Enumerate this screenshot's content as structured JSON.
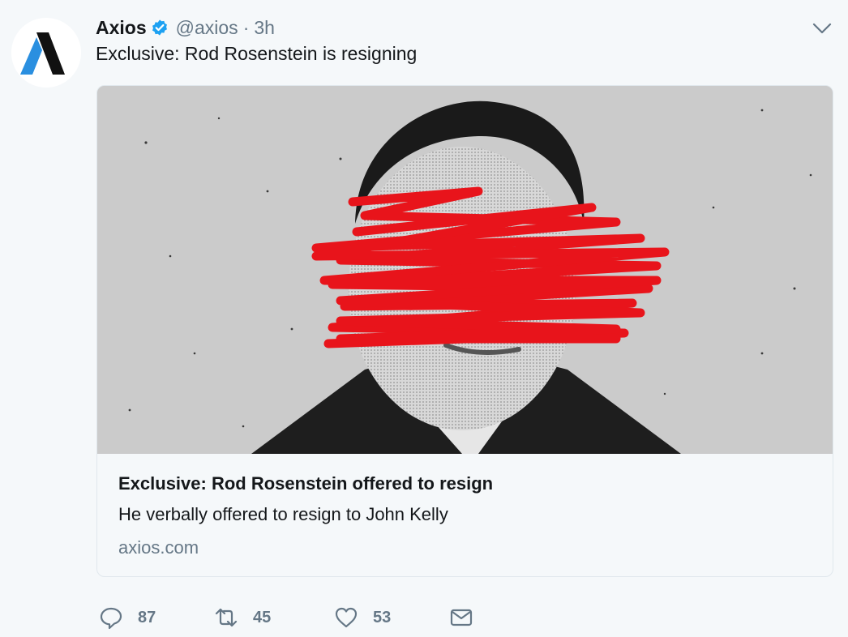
{
  "tweet": {
    "display_name": "Axios",
    "handle": "@axios",
    "separator": "·",
    "time": "3h",
    "text": "Exclusive: Rod Rosenstein is resigning"
  },
  "card": {
    "title": "Exclusive: Rod Rosenstein offered to resign",
    "description": "He verbally offered to resign to John Kelly",
    "domain": "axios.com"
  },
  "actions": {
    "reply_count": "87",
    "retweet_count": "45",
    "like_count": "53"
  },
  "icons": {
    "avatar": "axios-logo",
    "verified": "verified-badge-icon",
    "caret": "chevron-down-icon",
    "reply": "reply-icon",
    "retweet": "retweet-icon",
    "like": "heart-icon",
    "dm": "envelope-icon"
  },
  "colors": {
    "verified_blue": "#1da1f2",
    "secondary_text": "#657786",
    "primary_text": "#14171a",
    "scribble_red": "#e8141b",
    "logo_blue": "#2a8fe0"
  }
}
